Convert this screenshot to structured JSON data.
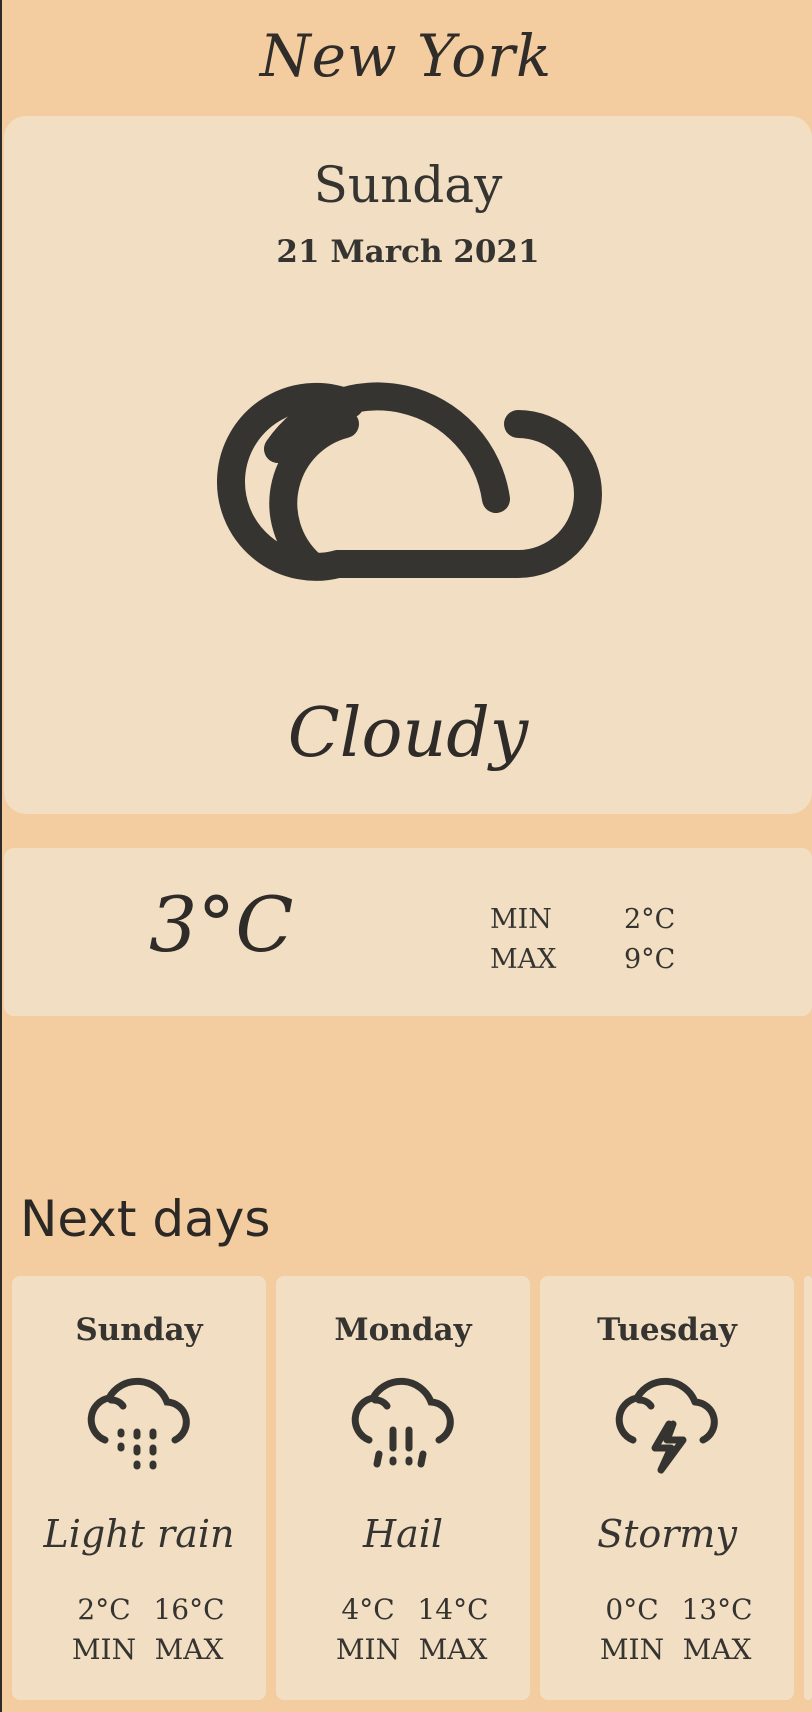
{
  "city": "New York",
  "today": {
    "day": "Sunday",
    "date": "21 March 2021",
    "icon": "cloud-icon",
    "condition": "Cloudy",
    "temperature": "3°C",
    "min_label": "MIN",
    "min_value": "2°C",
    "max_label": "MAX",
    "max_value": "9°C"
  },
  "next_days_title": "Next days",
  "forecast": [
    {
      "day": "Sunday",
      "icon": "light-rain-icon",
      "condition": "Light rain",
      "min": "2°C",
      "max": "16°C",
      "min_label": "MIN",
      "max_label": "MAX"
    },
    {
      "day": "Monday",
      "icon": "hail-icon",
      "condition": "Hail",
      "min": "4°C",
      "max": "14°C",
      "min_label": "MIN",
      "max_label": "MAX"
    },
    {
      "day": "Tuesday",
      "icon": "storm-icon",
      "condition": "Stormy",
      "min": "0°C",
      "max": "13°C",
      "min_label": "MIN",
      "max_label": "MAX"
    }
  ],
  "colors": {
    "background": "#f3cda0",
    "card": "#f2dfc3",
    "text": "#363431"
  }
}
